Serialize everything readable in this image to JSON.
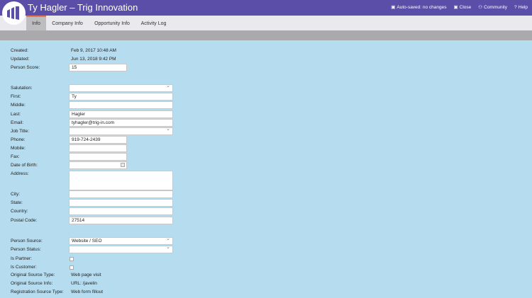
{
  "header": {
    "title": "Ty Hagler – Trig Innovation",
    "autosave": "Auto-saved: no changes",
    "close": "Close",
    "community": "Community",
    "help": "Help"
  },
  "tabs": [
    "Info",
    "Company Info",
    "Opportunity Info",
    "Activity Log"
  ],
  "form": {
    "created_label": "Created:",
    "created_value": "Feb 9, 2017 10:48 AM",
    "updated_label": "Updated:",
    "updated_value": "Jun 13, 2018 9:42 PM",
    "score_label": "Person Score:",
    "score_value": "15",
    "salutation_label": "Salutation:",
    "salutation_value": "",
    "first_label": "First:",
    "first_value": "Ty",
    "middle_label": "Middle:",
    "middle_value": "",
    "last_label": "Last:",
    "last_value": "Hagler",
    "email_label": "Email:",
    "email_value": "tyhagler@trig-in.com",
    "jobtitle_label": "Job Title:",
    "jobtitle_value": "",
    "phone_label": "Phone:",
    "phone_value": "919-724-2439",
    "mobile_label": "Mobile:",
    "mobile_value": "",
    "fax_label": "Fax:",
    "fax_value": "",
    "dob_label": "Date of Birth:",
    "dob_value": "",
    "address_label": "Address:",
    "city_label": "City:",
    "city_value": "",
    "state_label": "State:",
    "state_value": "",
    "country_label": "Country:",
    "country_value": "",
    "postal_label": "Postal Code:",
    "postal_value": "27514",
    "source_label": "Person Source:",
    "source_value": "Website / SEO",
    "status_label": "Person Status:",
    "status_value": "",
    "partner_label": "Is Partner:",
    "customer_label": "Is Customer:",
    "origsrc_label": "Original Source Type:",
    "origsrc_value": "Web page visit",
    "originfo_label": "Original Source Info:",
    "originfo_value": "URL: /javelin",
    "regsrc_label": "Registration Source Type:",
    "regsrc_value": "Web form fillout"
  }
}
